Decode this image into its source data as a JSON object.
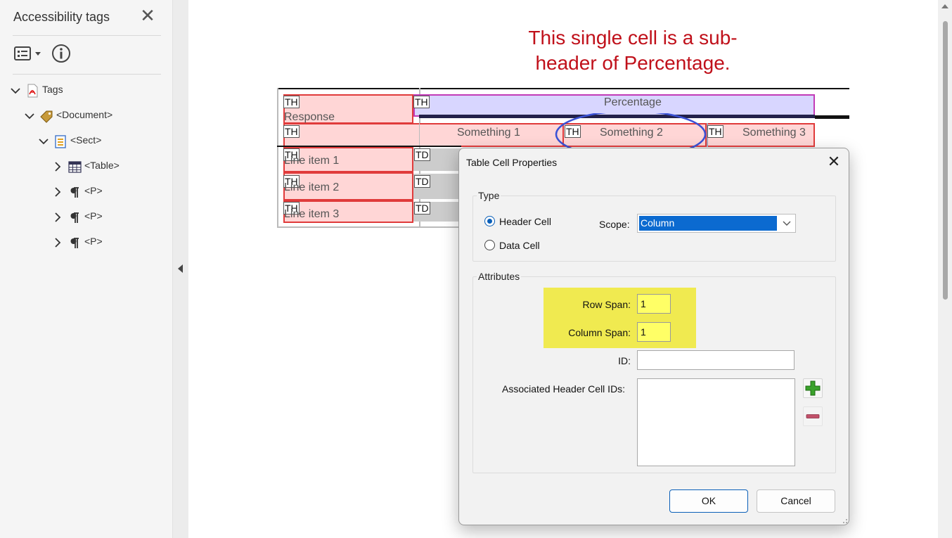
{
  "panel": {
    "title": "Accessibility tags",
    "close_glyph": "✕",
    "options_icon": "list-options-icon",
    "info_icon": "info-icon",
    "tree": [
      {
        "label": "Tags",
        "icon": "pdf-icon",
        "expanded": true
      },
      {
        "label": "<Document>",
        "icon": "tag-icon",
        "expanded": true
      },
      {
        "label": "<Sect>",
        "icon": "section-icon",
        "expanded": true
      },
      {
        "label": "<Table>",
        "icon": "table-icon",
        "expanded": false
      },
      {
        "label": "<P>",
        "icon": "paragraph-icon",
        "expanded": false
      },
      {
        "label": "<P>",
        "icon": "paragraph-icon",
        "expanded": false
      },
      {
        "label": "<P>",
        "icon": "paragraph-icon",
        "expanded": false
      }
    ]
  },
  "annotation": {
    "line1": "This single cell is a sub-",
    "line2": "header of Percentage.",
    "color": "#c0101a"
  },
  "table": {
    "header_row": {
      "tag1": "TH",
      "cell1": "Response",
      "tag2": "TH",
      "cell2": "Percentage"
    },
    "sub_header_row": {
      "tag": "TH",
      "cells": [
        {
          "tag": "",
          "text": "Something 1"
        },
        {
          "tag": "TH",
          "text": "Something 2"
        },
        {
          "tag": "TH",
          "text": "Something 3"
        }
      ]
    },
    "rows": [
      {
        "th": "TH",
        "label": "Line item 1",
        "td": "TD"
      },
      {
        "th": "TH",
        "label": "Line item 2",
        "td": "TD"
      },
      {
        "th": "TH",
        "label": "Line item 3",
        "td": "TD"
      }
    ],
    "highlight_colors": {
      "th": "#ffd6d6",
      "percentage": "#d8d6ff",
      "td": "#cccccc",
      "circle": "#3b52d6"
    }
  },
  "dialog": {
    "title": "Table Cell Properties",
    "close_glyph": "✕",
    "type_group": "Type",
    "header_cell_label": "Header Cell",
    "data_cell_label": "Data Cell",
    "selected_type": "Header Cell",
    "scope_label": "Scope:",
    "scope_value": "Column",
    "attributes_group": "Attributes",
    "row_span_label": "Row Span:",
    "row_span_value": "1",
    "column_span_label": "Column Span:",
    "column_span_value": "1",
    "id_label": "ID:",
    "id_value": "",
    "assoc_label": "Associated Header Cell IDs:",
    "add_icon": "plus-icon",
    "remove_icon": "minus-icon",
    "ok_label": "OK",
    "cancel_label": "Cancel",
    "highlight_color": "#f0ea50",
    "accent_color": "#0b6ad0"
  }
}
